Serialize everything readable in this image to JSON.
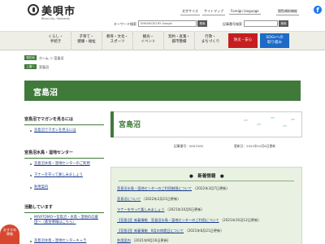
{
  "header": {
    "site_name": "美唄市",
    "site_romaji": "Bibai-city, Hokkaido",
    "links": [
      "文字サイズ",
      "サイトマップ",
      "Foreign language",
      "閲覧補助機能"
    ],
    "keyword_label": "キーワード検索",
    "keyword_placeholder": "ENHANCED BY Google",
    "search_button": "検索",
    "article_no_label": "記事番号検索",
    "article_search_button": "検索"
  },
  "gnav": {
    "items": [
      {
        "label": "くらし・\n手続き"
      },
      {
        "label": "子育て・\n健康・福祉"
      },
      {
        "label": "教育・文化・\nスポーツ"
      },
      {
        "label": "観光・\nイベント"
      },
      {
        "label": "契約・産業・\n都市整備"
      },
      {
        "label": "行政・\nまちづくり"
      },
      {
        "label": "防災・安心"
      },
      {
        "label": "SDGsへの\n取り組み"
      }
    ]
  },
  "breadcrumb": {
    "home_tag": "現在地",
    "home": "ホーム ＞ 宮島沼",
    "current_tag": "上層へ",
    "current": "宮島沼"
  },
  "page": {
    "title": "宮島沼",
    "content_title": "宮島沼",
    "page_id": "記事番号：0007200",
    "updated": "更新日：2021年10月6日更新"
  },
  "sidebar": {
    "section1_head": "宮島沼でマガンを見るには",
    "section1_links": [
      "宮島沼でマガンを見るには"
    ],
    "section2_head": "宮島沼水鳥・湿地センター",
    "section2_links": [
      "宮島沼水鳥・湿地センターのご利用",
      "マナーを守って楽しみましょう",
      "利用案内"
    ],
    "section3_head": "活動しています",
    "section3_links": [
      "MIYATOMO〜宮島沼・水鳥・湿地の応援団〜（基金情報はこちら）",
      "宮島沼水鳥・湿地センターキャラ"
    ]
  },
  "news": {
    "title": "新着情報",
    "items": [
      {
        "text": "宮島沼水鳥・湿地センターのご利用制限について",
        "date": "（2022年3月7日更新）"
      },
      {
        "text": "宮島沼について",
        "date": "（2022年2月21日更新）"
      },
      {
        "text": "マナーを守って楽しみましょう",
        "date": "（2021年10月6日更新）"
      },
      {
        "text": "【宮島沼】新着情報　宮島沼水鳥・湿地センターのご利用について",
        "date": "（2021年10月12日更新）"
      },
      {
        "text": "【宮島沼】新着情報　8月の休館日について",
        "date": "（2021年8月21日更新）"
      },
      {
        "text": "利用案内",
        "date": "（2021年9月16日更新）"
      }
    ]
  },
  "badge": {
    "label": "おすすめ\n情報"
  }
}
